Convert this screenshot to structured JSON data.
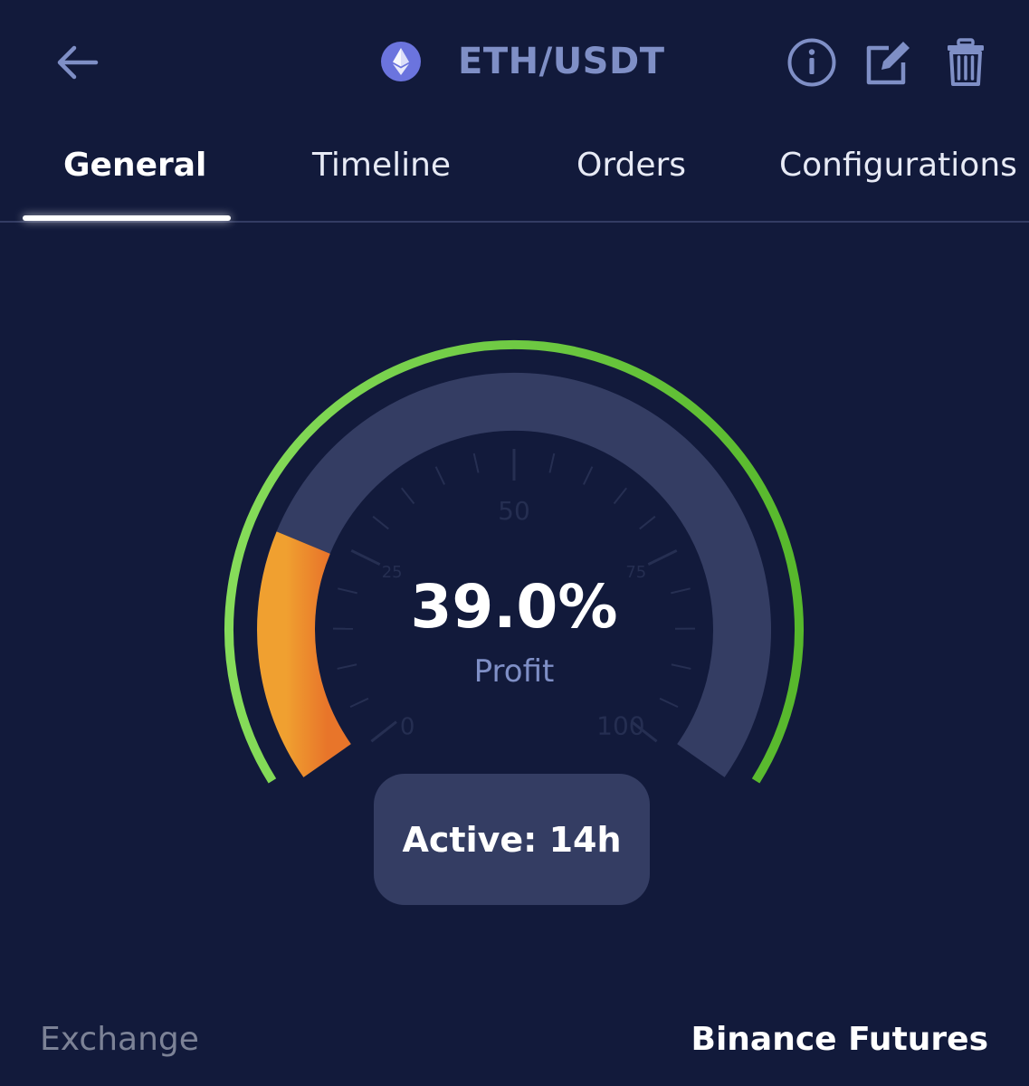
{
  "header": {
    "title": "ETH/USDT",
    "coin_icon": "ethereum-icon",
    "back_icon": "arrow-left-icon",
    "info_icon": "info-circle-icon",
    "edit_icon": "edit-icon",
    "delete_icon": "trash-icon"
  },
  "tabs": [
    {
      "label": "General",
      "active": true
    },
    {
      "label": "Timeline",
      "active": false
    },
    {
      "label": "Orders",
      "active": false
    },
    {
      "label": "Configurations",
      "active": false
    }
  ],
  "gauge": {
    "value_text": "39.0%",
    "value_label": "Profit",
    "level_percent": 39.0,
    "scale_labels": [
      "0",
      "25",
      "50",
      "75",
      "100"
    ],
    "scale_min": 0,
    "scale_max": 100,
    "colors": {
      "outer_ring": "#62c232",
      "track": "#343d63",
      "fill_start": "#f0a030",
      "fill_end": "#e8752a",
      "ticks": "#262f52"
    }
  },
  "status": {
    "active_text": "Active: 14h"
  },
  "exchange": {
    "label": "Exchange",
    "value": "Binance Futures"
  },
  "colors": {
    "background": "#121a3b",
    "accent_muted": "#7f8fc6"
  }
}
